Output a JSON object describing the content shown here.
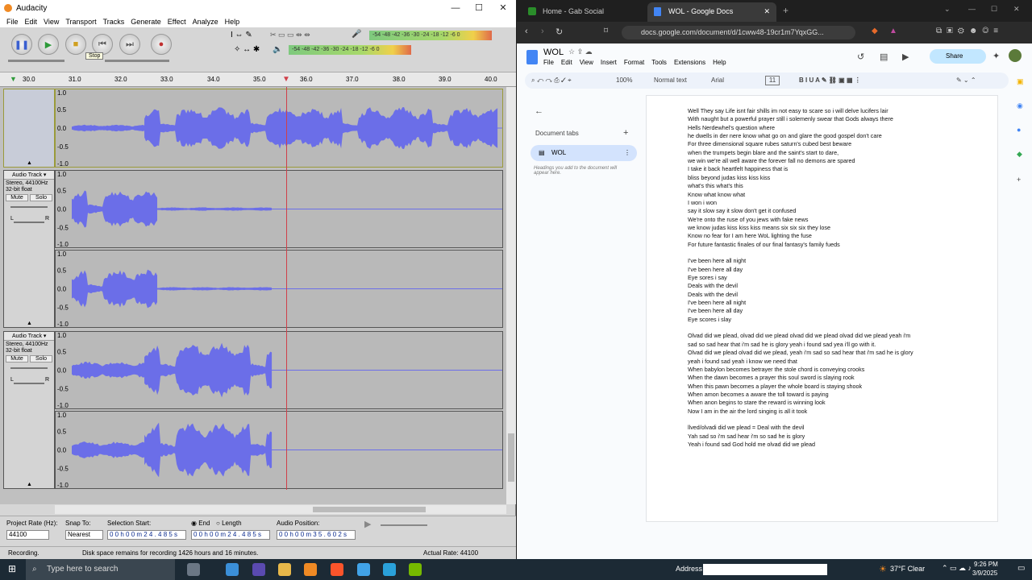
{
  "audacity": {
    "title": "Audacity",
    "menu": [
      "File",
      "Edit",
      "View",
      "Transport",
      "Tracks",
      "Generate",
      "Effect",
      "Analyze",
      "Help"
    ],
    "tooltip": "Stop",
    "meter_labels": "-54  -48  -42  -36  -30  -24  -18  -12  -6  0",
    "ruler": [
      "30.0",
      "31.0",
      "32.0",
      "33.0",
      "34.0",
      "35.0",
      "36.0",
      "37.0",
      "38.0",
      "39.0",
      "40.0"
    ],
    "amp_labels": [
      "1.0",
      "0.5",
      "0.0",
      "-0.5",
      "-1.0"
    ],
    "track_name": "Audio Track",
    "track_info1": "Stereo, 44100Hz",
    "track_info2": "32-bit float",
    "mute": "Mute",
    "solo": "Solo",
    "pan_l": "L",
    "pan_r": "R",
    "project_rate_label": "Project Rate (Hz):",
    "project_rate": "44100",
    "snap_label": "Snap To:",
    "snap_value": "Nearest",
    "sel_start_label": "Selection Start:",
    "end_label": "End",
    "length_label": "Length",
    "sel_start": "0 0 h 0 0 m 2 4 . 4 8 5 s",
    "sel_end": "0 0 h 0 0 m 2 4 . 4 8 5 s",
    "audio_pos_label": "Audio Position:",
    "audio_pos": "0 0 h 0 0 m 3 5 . 6 0 2 s",
    "status_left": "Recording.",
    "status_mid": "Disk space remains for recording 1426 hours and 16 minutes.",
    "status_right": "Actual Rate: 44100"
  },
  "browser": {
    "tab1": "Home - Gab Social",
    "tab2": "WOL - Google Docs",
    "url": "docs.google.com/document/d/1cww48-19cr1m7YqxGG...",
    "doc_title": "WOL",
    "doc_menu": [
      "File",
      "Edit",
      "View",
      "Insert",
      "Format",
      "Tools",
      "Extensions",
      "Help"
    ],
    "share": "Share",
    "zoom": "100%",
    "style": "Normal text",
    "font": "Arial",
    "size": "11",
    "doc_tabs": "Document tabs",
    "tab_name": "WOL",
    "headings_hint": "Headings you add to the document will appear here.",
    "lines": [
      "Well They say Life isnt fair shills im not easy to scare so i will delve lucifers lair",
      "With naught but a powerful prayer still i solemenly swear that Gods always there",
      "Hells Nerdewhel's question where",
      "he dwells in der nere know what go on and glare the good gospel don't care",
      "For three dimensional square rubes saturn's cubed best beware",
      " when the trumpets begin blare and the saint's start to dare,",
      "we win we're all well aware the forever fall no demons are spared",
      "I take it back heartfelt happiness that is",
      "bliss beyond judas kiss kiss kiss",
      "what's this what's this",
      "Know what know what",
      "I won i won",
      "say it slow say it slow don't get it confused",
      "We're onto the ruse of you jews with fake news",
      "we know judas kiss kiss kiss means six six six they lose",
      "Know no fear for I am here WoL lighting the fuse",
      "For  future fantastic finales of our final fantasy's family fueds",
      "",
      "I've been here all night",
      "I've been here all day",
      "Eye sores i say",
      "Deals with the devil",
      "Deals with the devil",
      "I've been here all night",
      "I've been here all day",
      "Eye scores i slay",
      "",
      "Olvad did we plead, olvad did we plead olvad did we plead olvad did we plead yeah i'm",
      "sad so sad hear that i'm sad he is glory yeah i found sad yea i'll go with it.",
      "Olvad did we plead olvad did we plead, yeah i'm sad so sad hear that i'm sad he is glory",
      "yeah i found sad yeah i know we need that",
      "When babylon becomes betrayer the stole chord is conveying crooks",
      "When the dawn becomes a prayer this soul sword is slaying rook",
      "When this pawn becomes a player the whole board is staying shook",
      "When amon becomes a aware the toll toward is paying",
      "When anon begins to stare the reward is winning look",
      "Now I am in the air the lord singing is all it took",
      "",
      "llved/olvadi did we plead = Deal with the devil",
      "Yah sad so i'm sad hear i'm so sad he is glory",
      "Yeah i found sad God hold me olvad did we plead"
    ]
  },
  "taskbar": {
    "search": "Type here to search",
    "address": "Address",
    "weather": "37°F  Clear",
    "time": "9:26 PM",
    "date": "3/9/2025"
  },
  "colors": {
    "wave": "#6b6ee8",
    "wave_light": "#9da0f2",
    "cursor": "#d0404a"
  }
}
